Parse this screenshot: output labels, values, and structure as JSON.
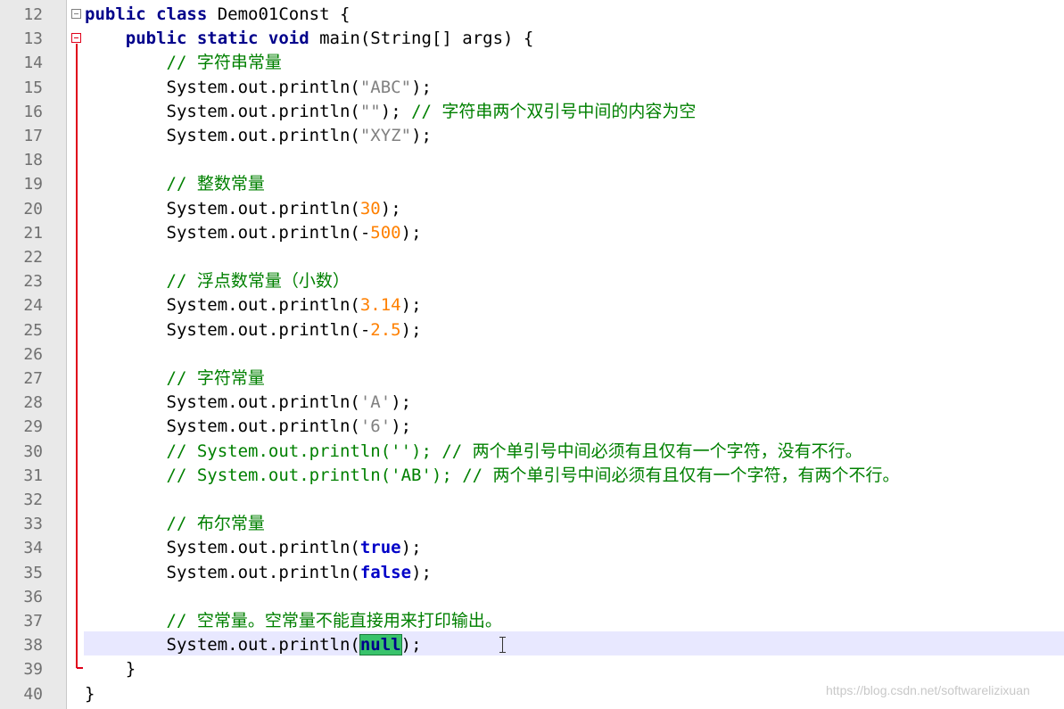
{
  "editor": {
    "colors": {
      "keyword": "#00008b",
      "string": "#808080",
      "number": "#ff8000",
      "comment": "#008000",
      "current_line": "#e8e8ff",
      "fold_marker": "#e0001a"
    },
    "lines": [
      {
        "number": "12",
        "parts": [
          {
            "t": "public class",
            "c": "kw"
          },
          {
            "t": " Demo01Const {",
            "c": "plain"
          }
        ]
      },
      {
        "number": "13",
        "parts": [
          {
            "t": "    ",
            "c": "plain"
          },
          {
            "t": "public static void",
            "c": "kw"
          },
          {
            "t": " main(String[] args) {",
            "c": "plain"
          }
        ]
      },
      {
        "number": "14",
        "parts": [
          {
            "t": "        // 字符串常量",
            "c": "cmt"
          }
        ]
      },
      {
        "number": "15",
        "parts": [
          {
            "t": "        System.out.println(",
            "c": "plain"
          },
          {
            "t": "\"ABC\"",
            "c": "str"
          },
          {
            "t": ");",
            "c": "plain"
          }
        ]
      },
      {
        "number": "16",
        "parts": [
          {
            "t": "        System.out.println(",
            "c": "plain"
          },
          {
            "t": "\"\"",
            "c": "str"
          },
          {
            "t": "); ",
            "c": "plain"
          },
          {
            "t": "// 字符串两个双引号中间的内容为空",
            "c": "cmt"
          }
        ]
      },
      {
        "number": "17",
        "parts": [
          {
            "t": "        System.out.println(",
            "c": "plain"
          },
          {
            "t": "\"XYZ\"",
            "c": "str"
          },
          {
            "t": ");",
            "c": "plain"
          }
        ]
      },
      {
        "number": "18",
        "parts": []
      },
      {
        "number": "19",
        "parts": [
          {
            "t": "        // 整数常量",
            "c": "cmt"
          }
        ]
      },
      {
        "number": "20",
        "parts": [
          {
            "t": "        System.out.println(",
            "c": "plain"
          },
          {
            "t": "30",
            "c": "num"
          },
          {
            "t": ");",
            "c": "plain"
          }
        ]
      },
      {
        "number": "21",
        "parts": [
          {
            "t": "        System.out.println(-",
            "c": "plain"
          },
          {
            "t": "500",
            "c": "num"
          },
          {
            "t": ");",
            "c": "plain"
          }
        ]
      },
      {
        "number": "22",
        "parts": []
      },
      {
        "number": "23",
        "parts": [
          {
            "t": "        // 浮点数常量（小数）",
            "c": "cmt"
          }
        ]
      },
      {
        "number": "24",
        "parts": [
          {
            "t": "        System.out.println(",
            "c": "plain"
          },
          {
            "t": "3.14",
            "c": "num"
          },
          {
            "t": ");",
            "c": "plain"
          }
        ]
      },
      {
        "number": "25",
        "parts": [
          {
            "t": "        System.out.println(-",
            "c": "plain"
          },
          {
            "t": "2.5",
            "c": "num"
          },
          {
            "t": ");",
            "c": "plain"
          }
        ]
      },
      {
        "number": "26",
        "parts": []
      },
      {
        "number": "27",
        "parts": [
          {
            "t": "        // 字符常量",
            "c": "cmt"
          }
        ]
      },
      {
        "number": "28",
        "parts": [
          {
            "t": "        System.out.println(",
            "c": "plain"
          },
          {
            "t": "'A'",
            "c": "str"
          },
          {
            "t": ");",
            "c": "plain"
          }
        ]
      },
      {
        "number": "29",
        "parts": [
          {
            "t": "        System.out.println(",
            "c": "plain"
          },
          {
            "t": "'6'",
            "c": "str"
          },
          {
            "t": ");",
            "c": "plain"
          }
        ]
      },
      {
        "number": "30",
        "parts": [
          {
            "t": "        // System.out.println(''); // 两个单引号中间必须有且仅有一个字符，没有不行。",
            "c": "cmt"
          }
        ]
      },
      {
        "number": "31",
        "parts": [
          {
            "t": "        // System.out.println('AB'); // 两个单引号中间必须有且仅有一个字符，有两个不行。",
            "c": "cmt"
          }
        ]
      },
      {
        "number": "32",
        "parts": []
      },
      {
        "number": "33",
        "parts": [
          {
            "t": "        // 布尔常量",
            "c": "cmt"
          }
        ]
      },
      {
        "number": "34",
        "parts": [
          {
            "t": "        System.out.println(",
            "c": "plain"
          },
          {
            "t": "true",
            "c": "kw2"
          },
          {
            "t": ");",
            "c": "plain"
          }
        ]
      },
      {
        "number": "35",
        "parts": [
          {
            "t": "        System.out.println(",
            "c": "plain"
          },
          {
            "t": "false",
            "c": "kw2"
          },
          {
            "t": ");",
            "c": "plain"
          }
        ]
      },
      {
        "number": "36",
        "parts": []
      },
      {
        "number": "37",
        "parts": [
          {
            "t": "        // 空常量。空常量不能直接用来打印输出。",
            "c": "cmt"
          }
        ]
      },
      {
        "number": "38",
        "parts": [
          {
            "t": "        System.out.println(",
            "c": "plain"
          },
          {
            "t": "null",
            "c": "hl"
          },
          {
            "t": ");",
            "c": "plain"
          }
        ]
      },
      {
        "number": "39",
        "parts": [
          {
            "t": "    }",
            "c": "plain"
          }
        ]
      },
      {
        "number": "40",
        "parts": [
          {
            "t": "}",
            "c": "plain"
          }
        ]
      }
    ],
    "fold_markers": [
      {
        "line": "12",
        "icon": "fold-minus-icon",
        "color": "#808080"
      },
      {
        "line": "13",
        "icon": "fold-minus-icon",
        "color": "#e0001a"
      }
    ]
  },
  "watermark": "https://blog.csdn.net/softwarelizixuan"
}
